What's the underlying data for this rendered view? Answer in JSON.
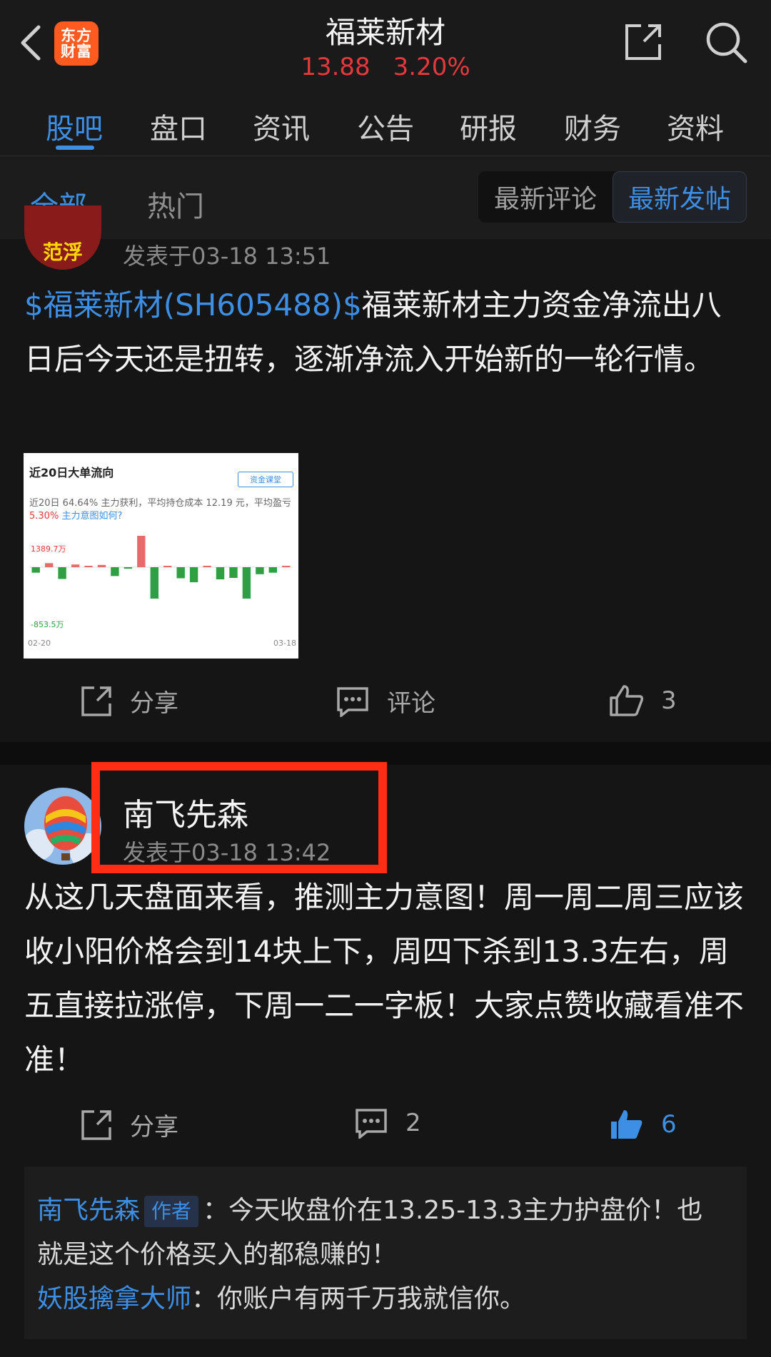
{
  "header": {
    "logo_line1": "东方",
    "logo_line2": "财富",
    "stock_name": "福莱新材",
    "price": "13.88",
    "change_pct": "3.20%"
  },
  "tabs": [
    "股吧",
    "盘口",
    "资讯",
    "公告",
    "研报",
    "财务",
    "资料"
  ],
  "subtabs": {
    "all": "全部",
    "hot": "热门"
  },
  "sort": {
    "latest_comment": "最新评论",
    "latest_post": "最新发帖"
  },
  "post1": {
    "avatar_text": "范浮",
    "time": "发表于03-18 13:51",
    "stock_link": "$福莱新材(SH605488)$",
    "text": "福莱新材主力资金净流出八日后今天还是扭转，逐渐净流入开始新的一轮行情。",
    "actions": {
      "share": "分享",
      "comment": "评论",
      "like_count": "3"
    },
    "chart_card": {
      "title": "近20日大单流向",
      "badge": "资金课堂",
      "desc_part1": "近20日 64.64% 主力获利，平均持仓成本 12.19 元，平均盈亏",
      "desc_pct": "5.30%",
      "desc_link": "主力意图如何?"
    }
  },
  "chart_data": {
    "type": "bar",
    "title": "近20日大单流向",
    "max_label": "1389.7万",
    "min_label": "-853.5万",
    "x_start": "02-20",
    "x_end": "03-18",
    "values": [
      -150,
      180,
      -320,
      120,
      0,
      100,
      -240,
      -40,
      1389.7,
      -853.5,
      40,
      -300,
      -410,
      0,
      -330,
      -290,
      -853.5,
      -190,
      -150,
      40
    ],
    "colors": {
      "positive": "#e86b6b",
      "negative": "#2ea043"
    }
  },
  "post2": {
    "author": "南飞先森",
    "time": "发表于03-18 13:42",
    "text": "从这几天盘面来看，推测主力意图！周一周二周三应该收小阳价格会到14块上下，周四下杀到13.3左右，周五直接拉涨停，下周一二一字板！大家点赞收藏看准不准！",
    "actions": {
      "share": "分享",
      "comment_count": "2",
      "like_count": "6"
    }
  },
  "comments": [
    {
      "name": "南飞先森",
      "badge": "作者",
      "text": "：今天收盘价在13.25-13.3主力护盘价！也就是这个价格买入的都稳赚的！"
    },
    {
      "name": "妖股擒拿大师",
      "text": "：你账户有两千万我就信你。"
    }
  ],
  "colors": {
    "accent": "#3d8fe6",
    "up": "#e4393c",
    "highlight": "#ff2d14"
  }
}
